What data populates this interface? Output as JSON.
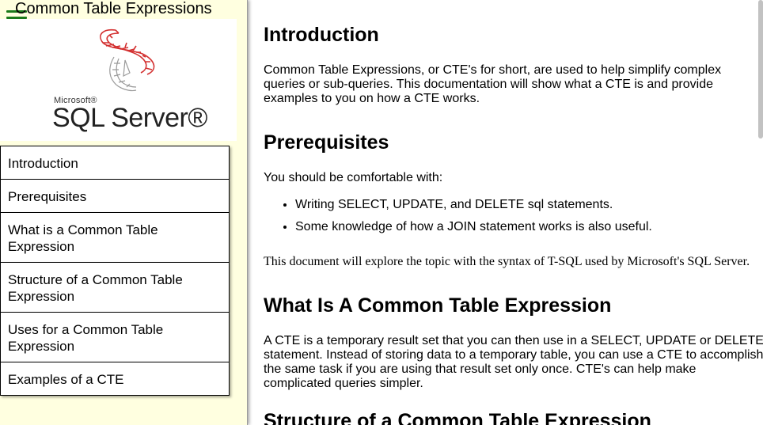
{
  "sidebar": {
    "title": "Common Table Expressions",
    "logo": {
      "brand_small": "Microsoft®",
      "brand_large": "SQL Server®"
    },
    "items": [
      {
        "label": "Introduction"
      },
      {
        "label": "Prerequisites"
      },
      {
        "label": "What is a Common Table Expression"
      },
      {
        "label": "Structure of a Common Table Expression"
      },
      {
        "label": "Uses for a Common Table Expression"
      },
      {
        "label": "Examples of a CTE"
      }
    ]
  },
  "main": {
    "intro": {
      "heading": "Introduction",
      "text": "Common Table Expressions, or CTE's for short, are used to help simplify complex queries or sub-queries. This documentation will show what a CTE is and provide examples to you on how a CTE works."
    },
    "prereq": {
      "heading": "Prerequisites",
      "lead": "You should be comfortable with:",
      "bullets": [
        "Writing SELECT, UPDATE, and DELETE sql statements.",
        "Some knowledge of how a JOIN statement works is also useful."
      ],
      "note": "This document will explore the topic with the syntax of T-SQL used by Microsoft's SQL Server."
    },
    "what": {
      "heading": "What Is A Common Table Expression",
      "text": "A CTE is a temporary result set that you can then use in a SELECT, UPDATE or DELETE statement. Instead of storing data to a temporary table, you can use a CTE to accomplish the same task if you are using that result set only once. CTE's can help make complicated queries simpler."
    },
    "structure": {
      "heading": "Structure of a Common Table Expression"
    }
  },
  "colors": {
    "sidebar_bg": "#ffffe0",
    "menu_icon": "#1a7a1a",
    "logo_red": "#d33030"
  }
}
